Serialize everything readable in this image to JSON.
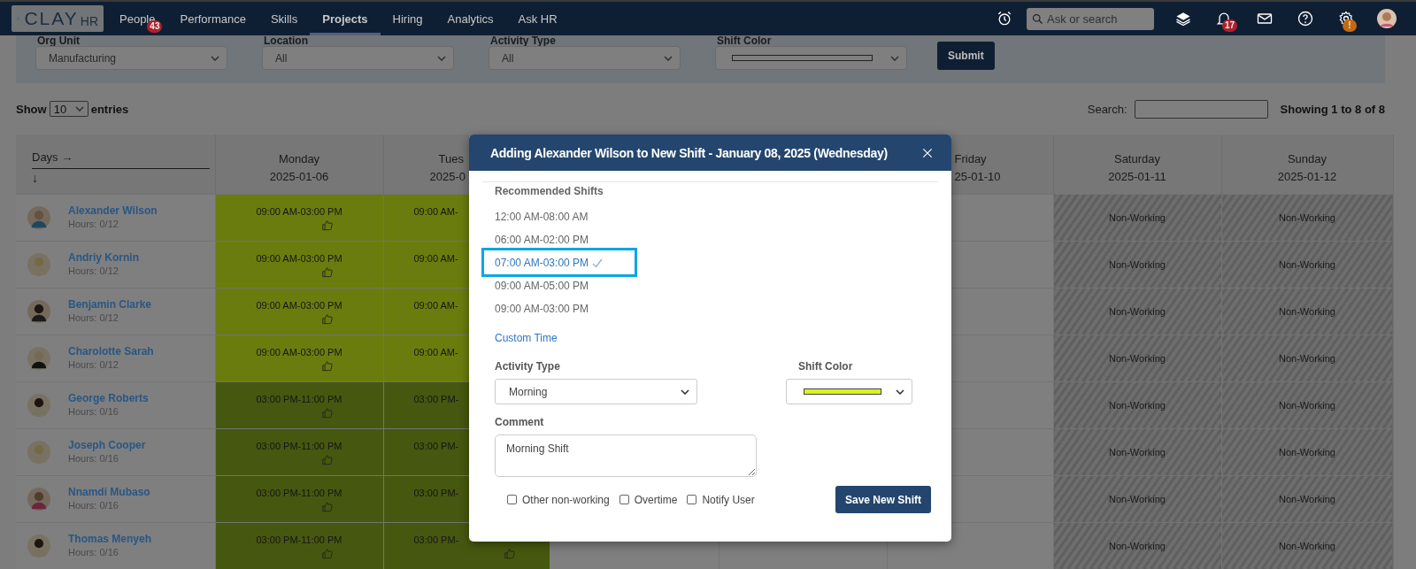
{
  "nav": {
    "logo": {
      "word": "CLAY",
      "suffix": "HR"
    },
    "items": [
      {
        "label": "People",
        "badge": "43",
        "selected": false
      },
      {
        "label": "Performance",
        "selected": false
      },
      {
        "label": "Skills",
        "selected": false
      },
      {
        "label": "Projects",
        "selected": true
      },
      {
        "label": "Hiring",
        "selected": false
      },
      {
        "label": "Analytics",
        "selected": false
      },
      {
        "label": "Ask HR",
        "selected": false
      }
    ],
    "tools": [
      {
        "kind": "alarm"
      },
      {
        "kind": "search",
        "placeholder": "Ask or search"
      },
      {
        "kind": "layers"
      },
      {
        "kind": "bell",
        "badge": "17"
      },
      {
        "kind": "mail"
      },
      {
        "kind": "help"
      },
      {
        "kind": "gear",
        "badge": "!"
      },
      {
        "kind": "avatar"
      }
    ]
  },
  "filters": [
    {
      "kind": "select",
      "label": "Org Unit",
      "value": "Manufacturing"
    },
    {
      "kind": "select",
      "label": "Location",
      "value": "All"
    },
    {
      "kind": "select",
      "label": "Activity Type",
      "value": "All"
    },
    {
      "kind": "swatch",
      "label": "Shift Color"
    }
  ],
  "submit": "Submit",
  "entries": {
    "show": "Show",
    "value": "10",
    "suffix": "entries"
  },
  "search": {
    "label": "Search:"
  },
  "info": "Showing 1 to 8 of 8",
  "table": {
    "corner": {
      "across": "Days →",
      "down": "↓"
    },
    "columns": [
      {
        "kind": "full",
        "day": "Monday",
        "date": "2025-01-06"
      },
      {
        "kind": "cut-right",
        "day": "Tues",
        "date": "2025-0"
      },
      {
        "kind": "hidden"
      },
      {
        "kind": "hidden"
      },
      {
        "kind": "cut-left",
        "day": "Friday",
        "date": "25-01-10"
      },
      {
        "kind": "full",
        "day": "Saturday",
        "date": "2025-01-11"
      },
      {
        "kind": "full",
        "day": "Sunday",
        "date": "2025-01-12"
      }
    ],
    "rows": [
      {
        "name": "Alexander Wilson",
        "hours": "Hours: 0/12",
        "cells": [
          {
            "kind": "shift",
            "time": "09:00 AM-03:00 PM",
            "color": "#6b7c0e",
            "thumb": true
          },
          {
            "kind": "shift-cut",
            "time": "09:00 AM-",
            "color": "#6b7c0e",
            "thumb": false
          },
          {
            "kind": "empty"
          },
          {
            "kind": "empty"
          },
          {
            "kind": "empty"
          },
          {
            "kind": "non-working",
            "text": "Non-Working"
          },
          {
            "kind": "non-working",
            "text": "Non-Working"
          }
        ]
      },
      {
        "name": "Andriy Kornin",
        "hours": "Hours: 0/12",
        "cells": [
          {
            "kind": "shift",
            "time": "09:00 AM-03:00 PM",
            "color": "#6b7c0e",
            "thumb": true
          },
          {
            "kind": "shift-cut",
            "time": "09:00 AM-",
            "color": "#6b7c0e",
            "thumb": false
          },
          {
            "kind": "empty"
          },
          {
            "kind": "empty"
          },
          {
            "kind": "empty"
          },
          {
            "kind": "non-working",
            "text": "Non-Working"
          },
          {
            "kind": "non-working",
            "text": "Non-Working"
          }
        ]
      },
      {
        "name": "Benjamin Clarke",
        "hours": "Hours: 0/12",
        "cells": [
          {
            "kind": "shift",
            "time": "09:00 AM-03:00 PM",
            "color": "#6b7c0e",
            "thumb": true
          },
          {
            "kind": "shift-cut",
            "time": "09:00 AM-",
            "color": "#6b7c0e",
            "thumb": false
          },
          {
            "kind": "empty"
          },
          {
            "kind": "empty"
          },
          {
            "kind": "empty"
          },
          {
            "kind": "non-working",
            "text": "Non-Working"
          },
          {
            "kind": "non-working",
            "text": "Non-Working"
          }
        ]
      },
      {
        "name": "Charolotte Sarah",
        "hours": "Hours: 0/12",
        "cells": [
          {
            "kind": "shift",
            "time": "09:00 AM-03:00 PM",
            "color": "#6b7c0e",
            "thumb": true
          },
          {
            "kind": "shift-cut",
            "time": "09:00 AM-",
            "color": "#6b7c0e",
            "thumb": false
          },
          {
            "kind": "empty"
          },
          {
            "kind": "empty"
          },
          {
            "kind": "empty"
          },
          {
            "kind": "non-working",
            "text": "Non-Working"
          },
          {
            "kind": "non-working",
            "text": "Non-Working"
          }
        ]
      },
      {
        "name": "George Roberts",
        "hours": "Hours: 0/16",
        "cells": [
          {
            "kind": "shift",
            "time": "03:00 PM-11:00 PM",
            "color": "#46580f",
            "thumb": true
          },
          {
            "kind": "shift-cut",
            "time": "03:00 PM-",
            "color": "#46580f",
            "thumb": false
          },
          {
            "kind": "empty"
          },
          {
            "kind": "empty"
          },
          {
            "kind": "empty"
          },
          {
            "kind": "non-working",
            "text": "Non-Working"
          },
          {
            "kind": "non-working",
            "text": "Non-Working"
          }
        ]
      },
      {
        "name": "Joseph Cooper",
        "hours": "Hours: 0/16",
        "cells": [
          {
            "kind": "shift",
            "time": "03:00 PM-11:00 PM",
            "color": "#46580f",
            "thumb": true
          },
          {
            "kind": "shift-cut",
            "time": "03:00 PM-",
            "color": "#46580f",
            "thumb": false
          },
          {
            "kind": "empty"
          },
          {
            "kind": "empty"
          },
          {
            "kind": "empty"
          },
          {
            "kind": "non-working",
            "text": "Non-Working"
          },
          {
            "kind": "non-working",
            "text": "Non-Working"
          }
        ]
      },
      {
        "name": "Nnamdi Mubaso",
        "hours": "Hours: 0/16",
        "cells": [
          {
            "kind": "shift",
            "time": "03:00 PM-11:00 PM",
            "color": "#46580f",
            "thumb": true
          },
          {
            "kind": "shift-cut",
            "time": "03:00 PM-",
            "color": "#46580f",
            "thumb": false
          },
          {
            "kind": "empty"
          },
          {
            "kind": "empty"
          },
          {
            "kind": "empty"
          },
          {
            "kind": "non-working",
            "text": "Non-Working"
          },
          {
            "kind": "non-working",
            "text": "Non-Working"
          }
        ]
      },
      {
        "name": "Thomas Menyeh",
        "hours": "Hours: 0/16",
        "cells": [
          {
            "kind": "shift",
            "time": "03:00 PM-11:00 PM",
            "color": "#46580f",
            "thumb": true
          },
          {
            "kind": "shift-cut",
            "time": "03:00 PM-",
            "color": "#46580f",
            "thumb": true
          },
          {
            "kind": "empty"
          },
          {
            "kind": "empty"
          },
          {
            "kind": "empty"
          },
          {
            "kind": "non-working",
            "text": "Non-Working"
          },
          {
            "kind": "non-working",
            "text": "Non-Working"
          }
        ]
      }
    ]
  },
  "modal": {
    "title": "Adding Alexander Wilson to New Shift - January 08, 2025 (Wednesday)",
    "section": "Recommended Shifts",
    "shifts": [
      {
        "time": "12:00 AM-08:00 AM",
        "selected": false
      },
      {
        "time": "06:00 AM-02:00 PM",
        "selected": false
      },
      {
        "time": "07:00 AM-03:00 PM",
        "selected": true
      },
      {
        "time": "09:00 AM-05:00 PM",
        "selected": false
      },
      {
        "time": "09:00 AM-03:00 PM",
        "selected": false
      }
    ],
    "custom": "Custom Time",
    "activity": {
      "label": "Activity Type",
      "value": "Morning"
    },
    "shift_color": {
      "label": "Shift Color",
      "color": "#d8f51f"
    },
    "comment": {
      "label": "Comment",
      "value": "Morning Shift"
    },
    "options": [
      {
        "label": "Other non-working",
        "checked": false
      },
      {
        "label": "Overtime",
        "checked": false
      },
      {
        "label": "Notify User",
        "checked": false
      }
    ],
    "save": "Save New Shift"
  }
}
